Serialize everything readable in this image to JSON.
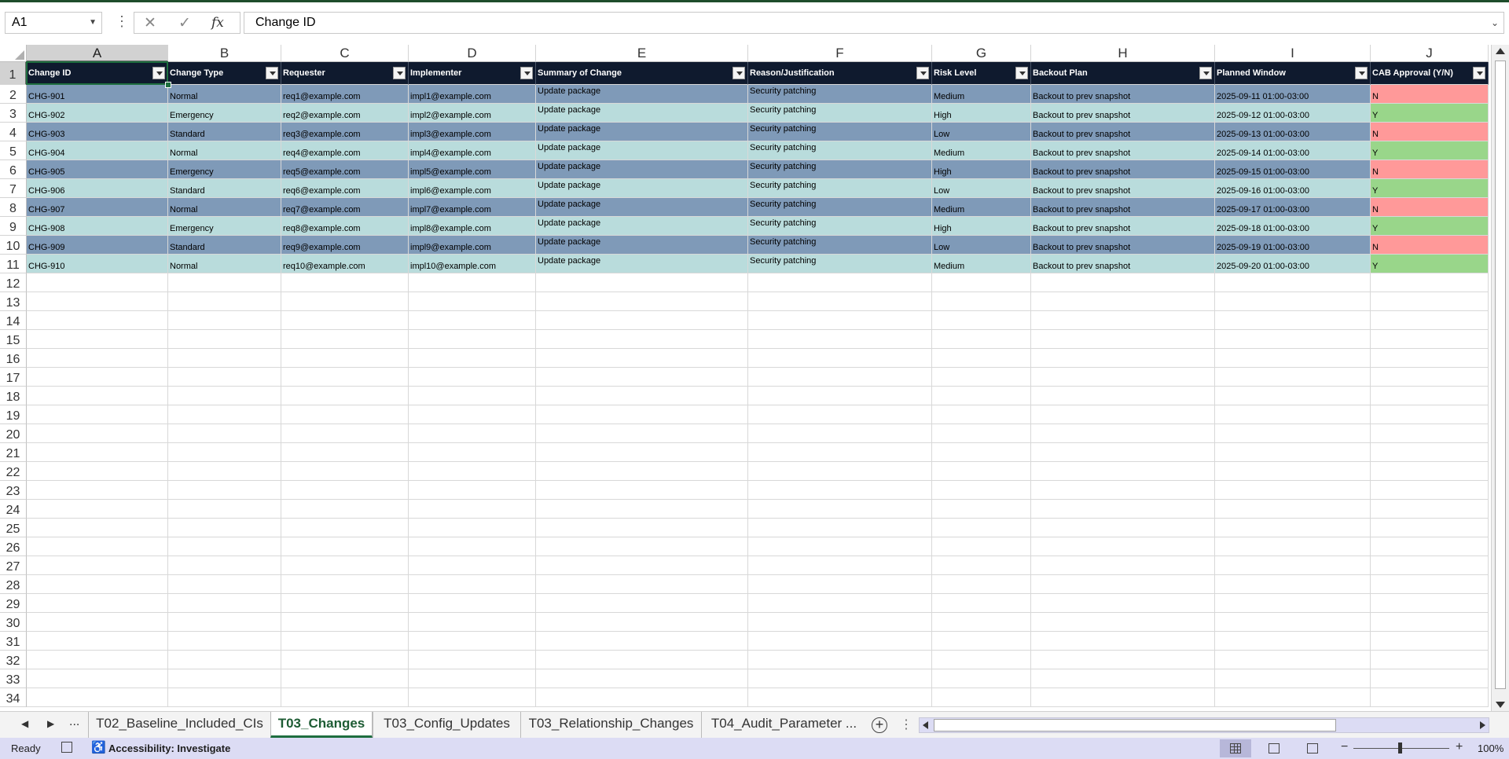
{
  "formula_bar": {
    "name_box": "A1",
    "formula": "Change ID",
    "fx_label": "fx"
  },
  "columns": [
    "A",
    "B",
    "C",
    "D",
    "E",
    "F",
    "G",
    "H",
    "I",
    "J"
  ],
  "row_numbers": [
    1,
    2,
    3,
    4,
    5,
    6,
    7,
    8,
    9,
    10,
    11,
    12,
    13,
    14,
    15,
    16,
    17,
    18,
    19,
    20,
    21,
    22,
    23,
    24,
    25,
    26,
    27,
    28,
    29,
    30,
    31,
    32,
    33,
    34
  ],
  "table": {
    "headers": [
      "Change ID",
      "Change Type",
      "Requester",
      "Implementer",
      "Summary of Change",
      "Reason/Justification",
      "Risk Level",
      "Backout Plan",
      "Planned Window",
      "CAB Approval (Y/N)"
    ],
    "rows": [
      [
        "CHG-901",
        "Normal",
        "req1@example.com",
        "impl1@example.com",
        "Update package",
        "Security patching",
        "Medium",
        "Backout to prev snapshot",
        "2025-09-11 01:00-03:00",
        "N"
      ],
      [
        "CHG-902",
        "Emergency",
        "req2@example.com",
        "impl2@example.com",
        "Update package",
        "Security patching",
        "High",
        "Backout to prev snapshot",
        "2025-09-12 01:00-03:00",
        "Y"
      ],
      [
        "CHG-903",
        "Standard",
        "req3@example.com",
        "impl3@example.com",
        "Update package",
        "Security patching",
        "Low",
        "Backout to prev snapshot",
        "2025-09-13 01:00-03:00",
        "N"
      ],
      [
        "CHG-904",
        "Normal",
        "req4@example.com",
        "impl4@example.com",
        "Update package",
        "Security patching",
        "Medium",
        "Backout to prev snapshot",
        "2025-09-14 01:00-03:00",
        "Y"
      ],
      [
        "CHG-905",
        "Emergency",
        "req5@example.com",
        "impl5@example.com",
        "Update package",
        "Security patching",
        "High",
        "Backout to prev snapshot",
        "2025-09-15 01:00-03:00",
        "N"
      ],
      [
        "CHG-906",
        "Standard",
        "req6@example.com",
        "impl6@example.com",
        "Update package",
        "Security patching",
        "Low",
        "Backout to prev snapshot",
        "2025-09-16 01:00-03:00",
        "Y"
      ],
      [
        "CHG-907",
        "Normal",
        "req7@example.com",
        "impl7@example.com",
        "Update package",
        "Security patching",
        "Medium",
        "Backout to prev snapshot",
        "2025-09-17 01:00-03:00",
        "N"
      ],
      [
        "CHG-908",
        "Emergency",
        "req8@example.com",
        "impl8@example.com",
        "Update package",
        "Security patching",
        "High",
        "Backout to prev snapshot",
        "2025-09-18 01:00-03:00",
        "Y"
      ],
      [
        "CHG-909",
        "Standard",
        "req9@example.com",
        "impl9@example.com",
        "Update package",
        "Security patching",
        "Low",
        "Backout to prev snapshot",
        "2025-09-19 01:00-03:00",
        "N"
      ],
      [
        "CHG-910",
        "Normal",
        "req10@example.com",
        "impl10@example.com",
        "Update package",
        "Security patching",
        "Medium",
        "Backout to prev snapshot",
        "2025-09-20 01:00-03:00",
        "Y"
      ]
    ]
  },
  "colors": {
    "header_bg": "#0f1a2e",
    "band_odd": "#7f9ab8",
    "band_even": "#b9dcdc",
    "approval_no": "#ff9999",
    "approval_yes": "#99d68a",
    "accent": "#1e6e3f"
  },
  "sheet_tabs": {
    "more": "...",
    "tabs": [
      {
        "label": "T02_Baseline_Included_CIs",
        "active": false
      },
      {
        "label": "T03_Changes",
        "active": true
      },
      {
        "label": "T03_Config_Updates",
        "active": false
      },
      {
        "label": "T03_Relationship_Changes",
        "active": false
      },
      {
        "label": "T04_Audit_Parameter ...",
        "active": false
      }
    ],
    "add_label": "+",
    "options_label": "⋮"
  },
  "status_bar": {
    "ready": "Ready",
    "accessibility": "Accessibility: Investigate",
    "zoom": "100%",
    "zoom_minus": "−",
    "zoom_plus": "+"
  },
  "icons": {
    "cancel": "close-icon",
    "enter": "check-icon",
    "function": "fx-icon",
    "accessibility": "accessibility-icon",
    "macro": "macro-record-icon"
  }
}
